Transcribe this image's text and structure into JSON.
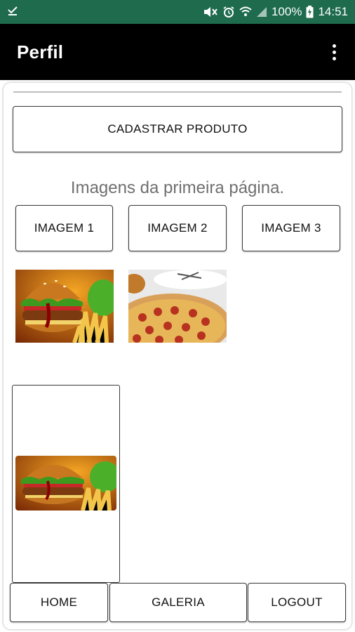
{
  "status_bar": {
    "battery_percent": "100%",
    "time": "14:51",
    "icons": [
      "download-done-icon",
      "mute-icon",
      "alarm-icon",
      "wifi-icon",
      "signal-icon",
      "battery-charging-icon"
    ],
    "background": "#1e6b4e"
  },
  "app_bar": {
    "title": "Perfil",
    "menu_icon": "overflow-menu-icon",
    "background": "#000000"
  },
  "actions": {
    "register_product": "CADASTRAR PRODUTO"
  },
  "section": {
    "title": "Imagens da primeira página."
  },
  "image_buttons": [
    "IMAGEM 1",
    "IMAGEM 2",
    "IMAGEM 3"
  ],
  "thumbnails": [
    {
      "slot": 1,
      "depicts": "burger-image"
    },
    {
      "slot": 2,
      "depicts": "pizza-image"
    }
  ],
  "preview": {
    "depicts": "burger-image"
  },
  "bottom_nav": {
    "home": "HOME",
    "gallery": "GALERIA",
    "logout": "LOGOUT"
  }
}
